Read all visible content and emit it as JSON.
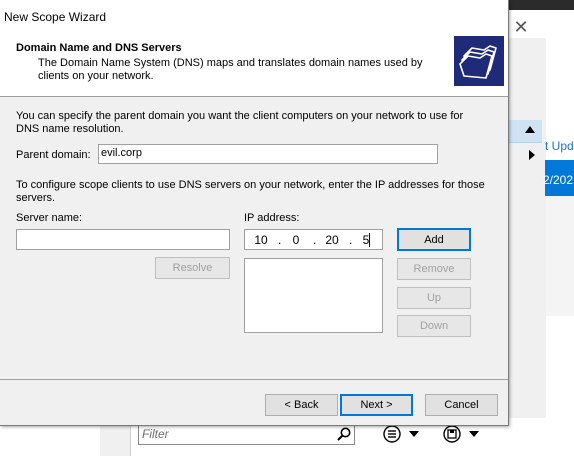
{
  "background_app": {
    "link_text": "t Upd",
    "selected_date": "2/202",
    "filter_placeholder": "Filter",
    "close_glyph": "✕"
  },
  "wizard": {
    "title": "New Scope Wizard",
    "header": {
      "title": "Domain Name and DNS Servers",
      "description": "The Domain Name System (DNS) maps and translates domain names used by clients on your network."
    },
    "intro_text": "You can specify the parent domain you want the client computers on your network to use for DNS name resolution.",
    "parent_domain": {
      "label": "Parent domain:",
      "value": "evil.corp"
    },
    "dns_intro": "To configure scope clients to use DNS servers on your network, enter the IP addresses for those servers.",
    "server_name": {
      "label": "Server name:",
      "value": ""
    },
    "ip_address": {
      "label": "IP address:",
      "octets": [
        "10",
        "0",
        "20",
        "5"
      ]
    },
    "buttons": {
      "resolve": "Resolve",
      "add": "Add",
      "remove": "Remove",
      "up": "Up",
      "down": "Down",
      "back": "< Back",
      "next": "Next >",
      "cancel": "Cancel"
    }
  }
}
